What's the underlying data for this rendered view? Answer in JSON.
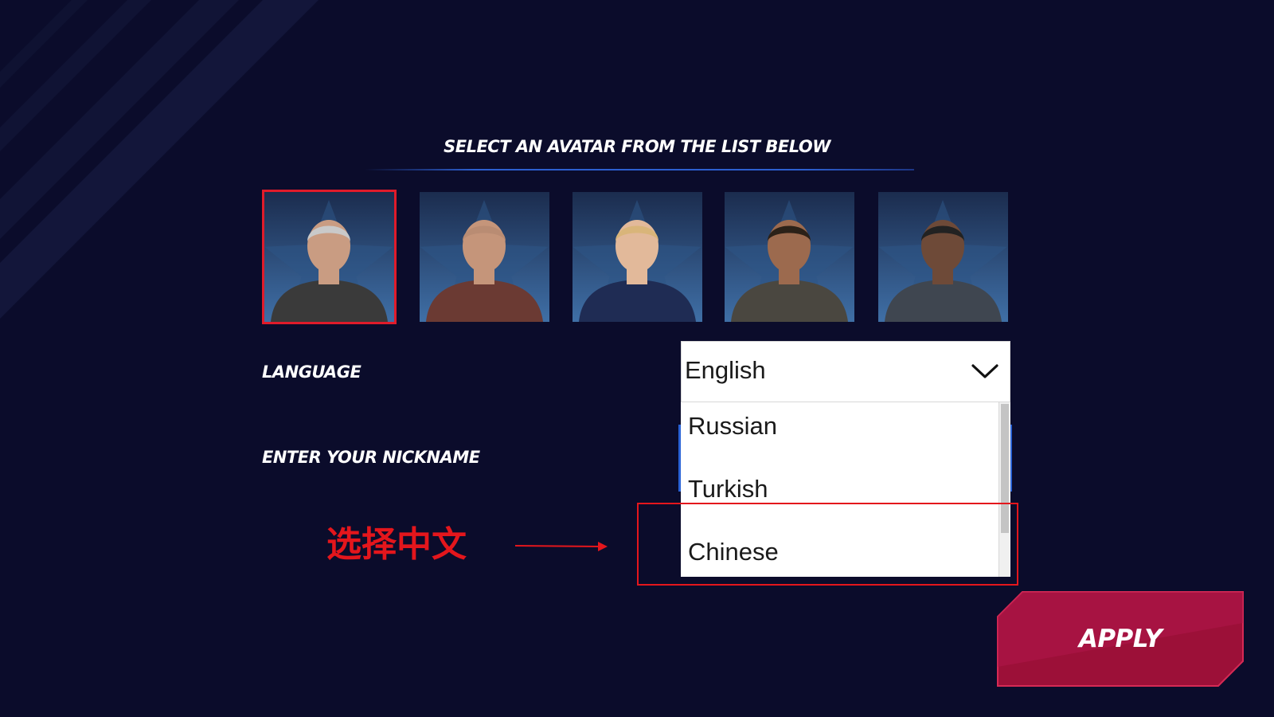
{
  "heading": "SELECT AN AVATAR FROM THE LIST BELOW",
  "avatars": [
    {
      "name": "avatar-1",
      "hair": "#c9c9c9",
      "skin": "#c99c82",
      "shirt": "#3a3a3a",
      "selected": true
    },
    {
      "name": "avatar-2",
      "hair": "#b98c73",
      "skin": "#c5957a",
      "shirt": "#6b3a33",
      "selected": false
    },
    {
      "name": "avatar-3",
      "hair": "#d9b57a",
      "skin": "#e2b99a",
      "shirt": "#1f2c54",
      "selected": false
    },
    {
      "name": "avatar-4",
      "hair": "#2b2118",
      "skin": "#9c6a4e",
      "shirt": "#4a4740",
      "selected": false
    },
    {
      "name": "avatar-5",
      "hair": "#222222",
      "skin": "#6e4a38",
      "shirt": "#3f4650",
      "selected": false
    }
  ],
  "language": {
    "label": "LANGUAGE",
    "selected": "English",
    "options": [
      "Russian",
      "Turkish",
      "Chinese"
    ]
  },
  "nickname": {
    "label": "ENTER YOUR NICKNAME"
  },
  "annotation": {
    "text": "选择中文"
  },
  "apply": {
    "label": "APPLY"
  },
  "colors": {
    "background": "#0b0c2b",
    "accent_red": "#e4161c",
    "apply_button": "#a0113a",
    "rule_blue": "#2d5fcf"
  }
}
